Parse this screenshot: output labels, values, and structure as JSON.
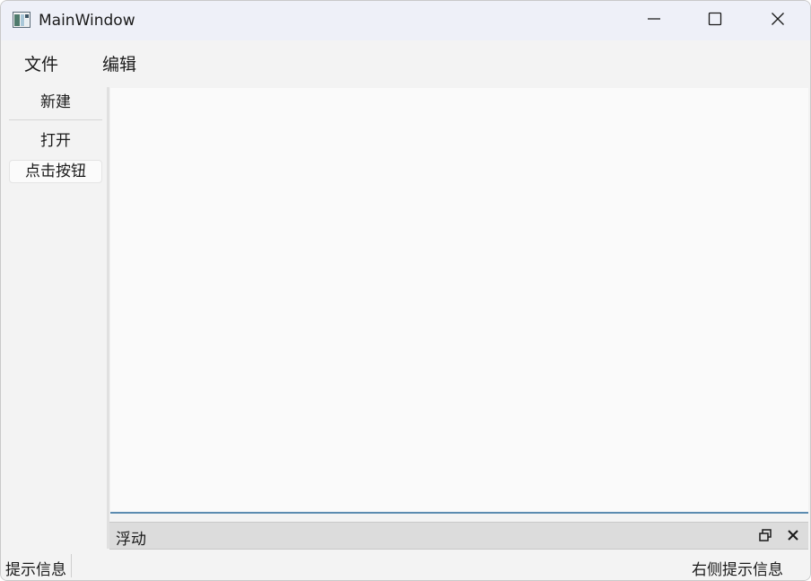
{
  "window": {
    "title": "MainWindow",
    "minimize_icon": "minimize-icon",
    "maximize_icon": "maximize-icon",
    "close_icon": "close-icon"
  },
  "menubar": {
    "items": [
      {
        "label": "文件"
      },
      {
        "label": "编辑"
      }
    ]
  },
  "toolbar": {
    "buttons": [
      {
        "label": "新建"
      },
      {
        "label": "打开"
      },
      {
        "label": "点击按钮"
      }
    ]
  },
  "dock": {
    "title": "浮动",
    "float_icon": "float-icon",
    "close_icon": "close-icon"
  },
  "statusbar": {
    "left": "提示信息",
    "right": "右侧提示信息"
  },
  "colors": {
    "title_bg": "#eef0f8",
    "window_bg": "#f3f3f3",
    "central_bg": "#fafafa",
    "dock_title_bg": "#dcdcdc",
    "accent_line": "#5b8bb0"
  }
}
